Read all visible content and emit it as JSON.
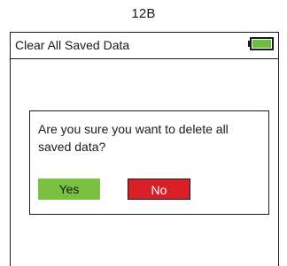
{
  "figure_label": "12B",
  "header": {
    "title": "Clear All Saved Data",
    "battery_icon": "battery-full-icon",
    "battery_color": "#6cbf3f",
    "battery_level": 1.0
  },
  "dialog": {
    "message": "Are you sure you want to delete all saved data?",
    "yes_label": "Yes",
    "no_label": "No",
    "yes_color": "#7ac142",
    "no_color": "#d81e26"
  }
}
